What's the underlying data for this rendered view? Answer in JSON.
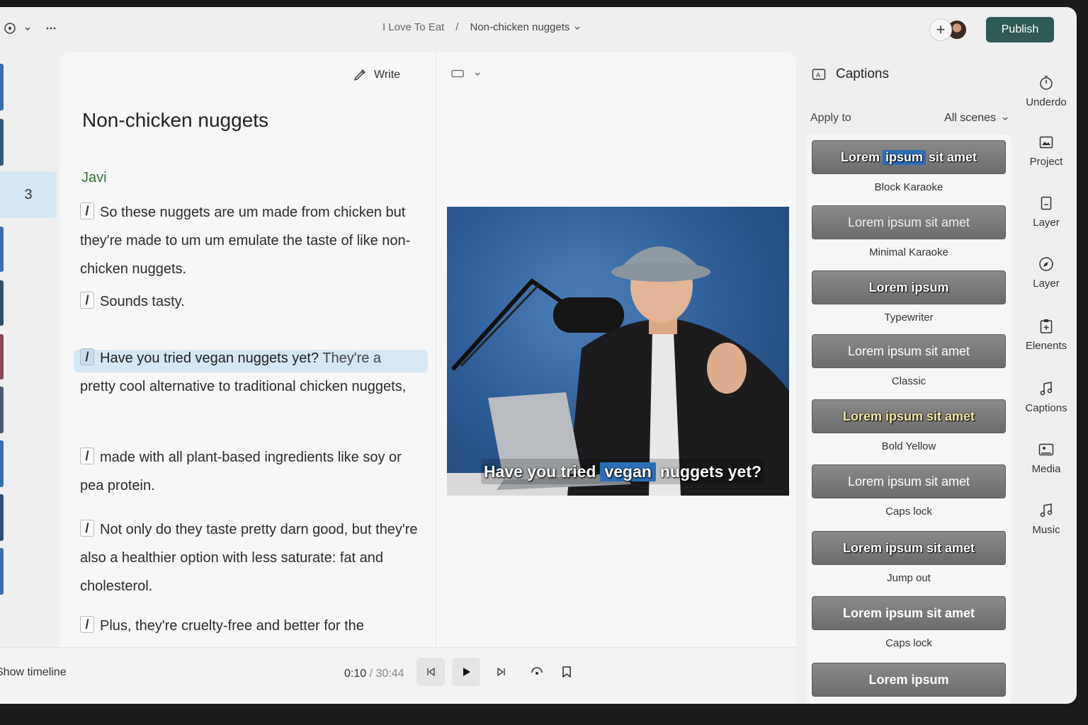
{
  "topbar": {
    "breadcrumb_project": "I Love To Eat",
    "breadcrumb_sep": "/",
    "breadcrumb_doc": "Non-chicken nuggets",
    "publish_label": "Publish"
  },
  "strip": {
    "active_scene": "3"
  },
  "script": {
    "write_label": "Write",
    "title": "Non-chicken nuggets",
    "speaker": "Javi",
    "paragraphs": [
      "So these nuggets are um made from chicken but they're made to um um emulate the taste of like non-chicken nuggets.",
      "Sounds tasty.",
      "pretty cool alternative to traditional chicken nuggets,",
      "made with all plant-based ingredients like soy or pea protein.",
      "Not only do they taste pretty darn good, but they're also a healthier option with less saturate: fat and cholesterol.",
      "Plus, they're cruelty-free and better for the environment since they don't require any animal"
    ],
    "highlight_strong": "Have you tried vegan nuggets yet?",
    "highlight_rest": "They're a"
  },
  "video": {
    "caption_pre": "Have you tried",
    "caption_hi": "vegan",
    "caption_post": "nuggets yet?"
  },
  "bottombar": {
    "show_timeline": "Show timeline",
    "current_time": "0:10",
    "time_sep": "/",
    "total_time": "30:44"
  },
  "captions_panel": {
    "title": "Captions",
    "apply_to_label": "Apply to",
    "apply_to_value": "All scenes",
    "styles": [
      {
        "label": "Block Karaoke",
        "w1": "Lorem",
        "hi": "ipsum",
        "w2": "sit amet"
      },
      {
        "label": "Minimal Karaoke",
        "text": "Lorem ipsum sit amet"
      },
      {
        "label": "Typewriter",
        "text": "Lorem ipsum"
      },
      {
        "label": "Classic",
        "text": "Lorem ipsum sit amet"
      },
      {
        "label": "Bold Yellow",
        "text": "Lorem ipsum sit amet"
      },
      {
        "label": "Caps lock",
        "text": "Lorem ipsum sit amet"
      },
      {
        "label": "Jump out",
        "text": "Lorem ipsum sit amet"
      },
      {
        "label": "Caps lock",
        "text": "Lorem ipsum sit amet"
      },
      {
        "text": "Lorem ipsum"
      }
    ]
  },
  "rail": {
    "items": [
      {
        "label": "Underdo",
        "icon": "timer-icon"
      },
      {
        "label": "Project",
        "icon": "image-icon"
      },
      {
        "label": "Layer",
        "icon": "document-icon"
      },
      {
        "label": "Layer",
        "icon": "compass-icon"
      },
      {
        "label": "Elenents",
        "icon": "clipboard-icon"
      },
      {
        "label": "Captions",
        "icon": "music-note-icon"
      },
      {
        "label": "Media",
        "icon": "media-icon"
      },
      {
        "label": "Music",
        "icon": "music-icon"
      }
    ]
  },
  "colors": {
    "publish": "#2f5a56",
    "highlight": "#d6e7f4",
    "speaker": "#3b6e3b",
    "caption_highlight": "#2a6fb8"
  }
}
